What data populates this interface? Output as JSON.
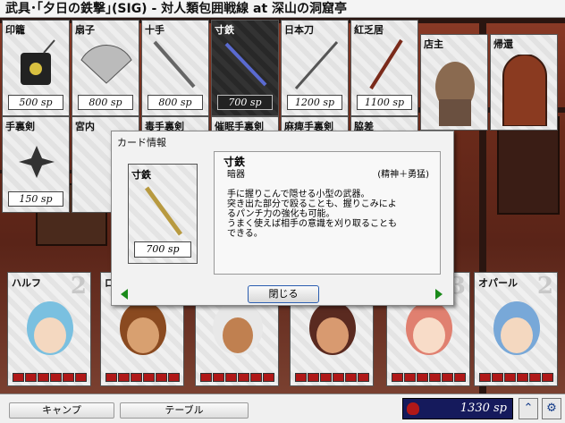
{
  "title": "武具･｢夕日の鉄撃｣(SIG) - 対人類包囲戦線 at 深山の洞窟亭",
  "shop_cards": [
    {
      "name": "印籠",
      "price": "500 sp"
    },
    {
      "name": "扇子",
      "price": "800 sp"
    },
    {
      "name": "十手",
      "price": "800 sp"
    },
    {
      "name": "寸鉄",
      "price": "700 sp"
    },
    {
      "name": "日本刀",
      "price": "1200 sp"
    },
    {
      "name": "紅乏居",
      "price": "1100 sp"
    },
    {
      "name": "手裏剣",
      "price": "150 sp"
    },
    {
      "name": "宮内",
      "price": ""
    },
    {
      "name": "毒手裏剣",
      "price": ""
    },
    {
      "name": "催眠手裏剣",
      "price": ""
    },
    {
      "name": "麻痺手裏剣",
      "price": ""
    },
    {
      "name": "脇差",
      "price": ""
    }
  ],
  "npc_cards": [
    {
      "name": "店主"
    },
    {
      "name": "帰還"
    }
  ],
  "dialog": {
    "title": "カード情報",
    "card_name": "寸鉄",
    "card_price": "700 sp",
    "item_name": "寸鉄",
    "category": "暗器",
    "attributes": "(精神＋勇猛)",
    "description": [
      "手に握りこんで隠せる小型の武器。",
      "突き出た部分で殴ることも、握りこみによ",
      "るパンチ力の強化も可能。",
      "うまく使えば相手の意識を刈り取ることも",
      "できる。"
    ],
    "close_label": "閉じる"
  },
  "party": [
    {
      "name": "ハルフ",
      "level": "2",
      "hp": 6
    },
    {
      "name": "ロ",
      "level": "",
      "hp": 6
    },
    {
      "name": "",
      "level": "",
      "hp": 6
    },
    {
      "name": "",
      "level": "",
      "hp": 6
    },
    {
      "name": "",
      "level": "3",
      "hp": 6
    },
    {
      "name": "オパール",
      "level": "2",
      "hp": 6
    }
  ],
  "bottom": {
    "camp_label": "キャンプ",
    "table_label": "テーブル",
    "money": "1330 sp",
    "up_icon": "double-chevron-up-icon",
    "settings_icon": "gear-icon"
  },
  "colors": {
    "money_bg": "#151a5c",
    "hp_bar": "#b01818",
    "nav_arrow": "#1a8a1a"
  }
}
